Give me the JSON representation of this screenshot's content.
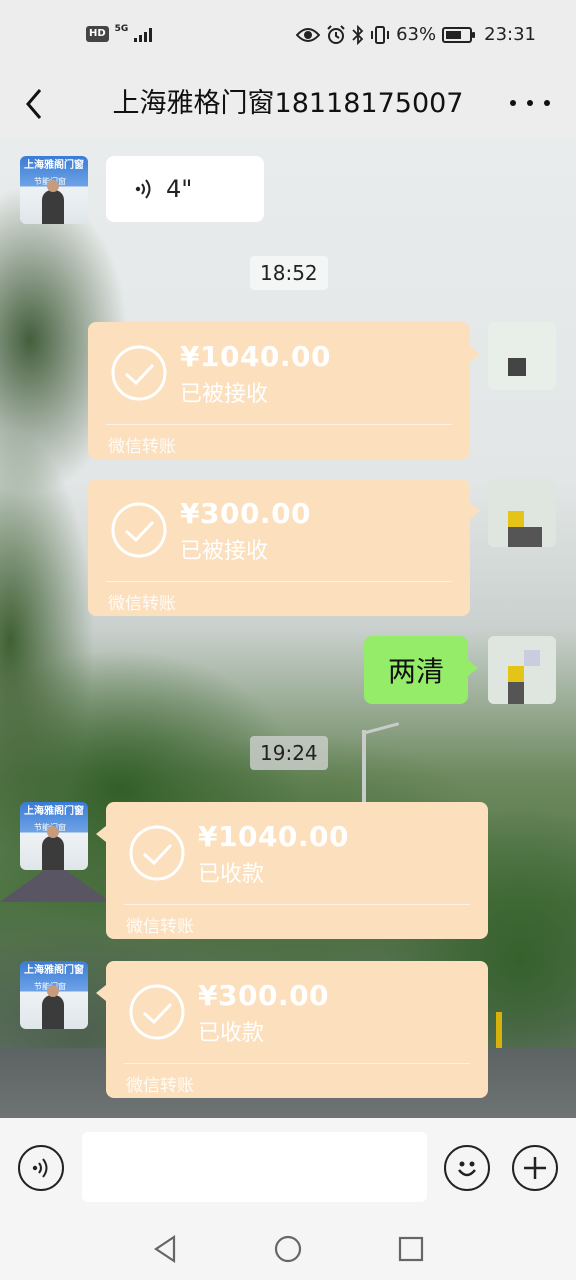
{
  "status_bar": {
    "hd": "HD",
    "network": "5G",
    "battery_percent": "63%",
    "battery_level": 0.63,
    "time": "23:31"
  },
  "header": {
    "title": "上海雅格门窗18118175007"
  },
  "shop_avatar": {
    "line1": "上海雅阁门窗",
    "line2": "节能门窗"
  },
  "messages": {
    "voice": {
      "duration": "4\""
    },
    "timestamp_1": "18:52",
    "transfer_1": {
      "amount": "¥1040.00",
      "status": "已被接收",
      "footer": "微信转账"
    },
    "transfer_2": {
      "amount": "¥300.00",
      "status": "已被接收",
      "footer": "微信转账"
    },
    "text_1": "两清",
    "timestamp_2": "19:24",
    "transfer_3": {
      "amount": "¥1040.00",
      "status": "已收款",
      "footer": "微信转账"
    },
    "transfer_4": {
      "amount": "¥300.00",
      "status": "已收款",
      "footer": "微信转账"
    }
  },
  "input": {
    "value": "",
    "placeholder": ""
  },
  "colors": {
    "transfer_bg": "#fcdfbd",
    "my_bubble": "#95ec69",
    "background": "#ededed"
  },
  "icons": [
    "back-icon",
    "more-icon",
    "voice-icon",
    "check-icon",
    "emoji-icon",
    "plus-icon",
    "nav-back-icon",
    "nav-home-icon",
    "nav-recents-icon"
  ]
}
